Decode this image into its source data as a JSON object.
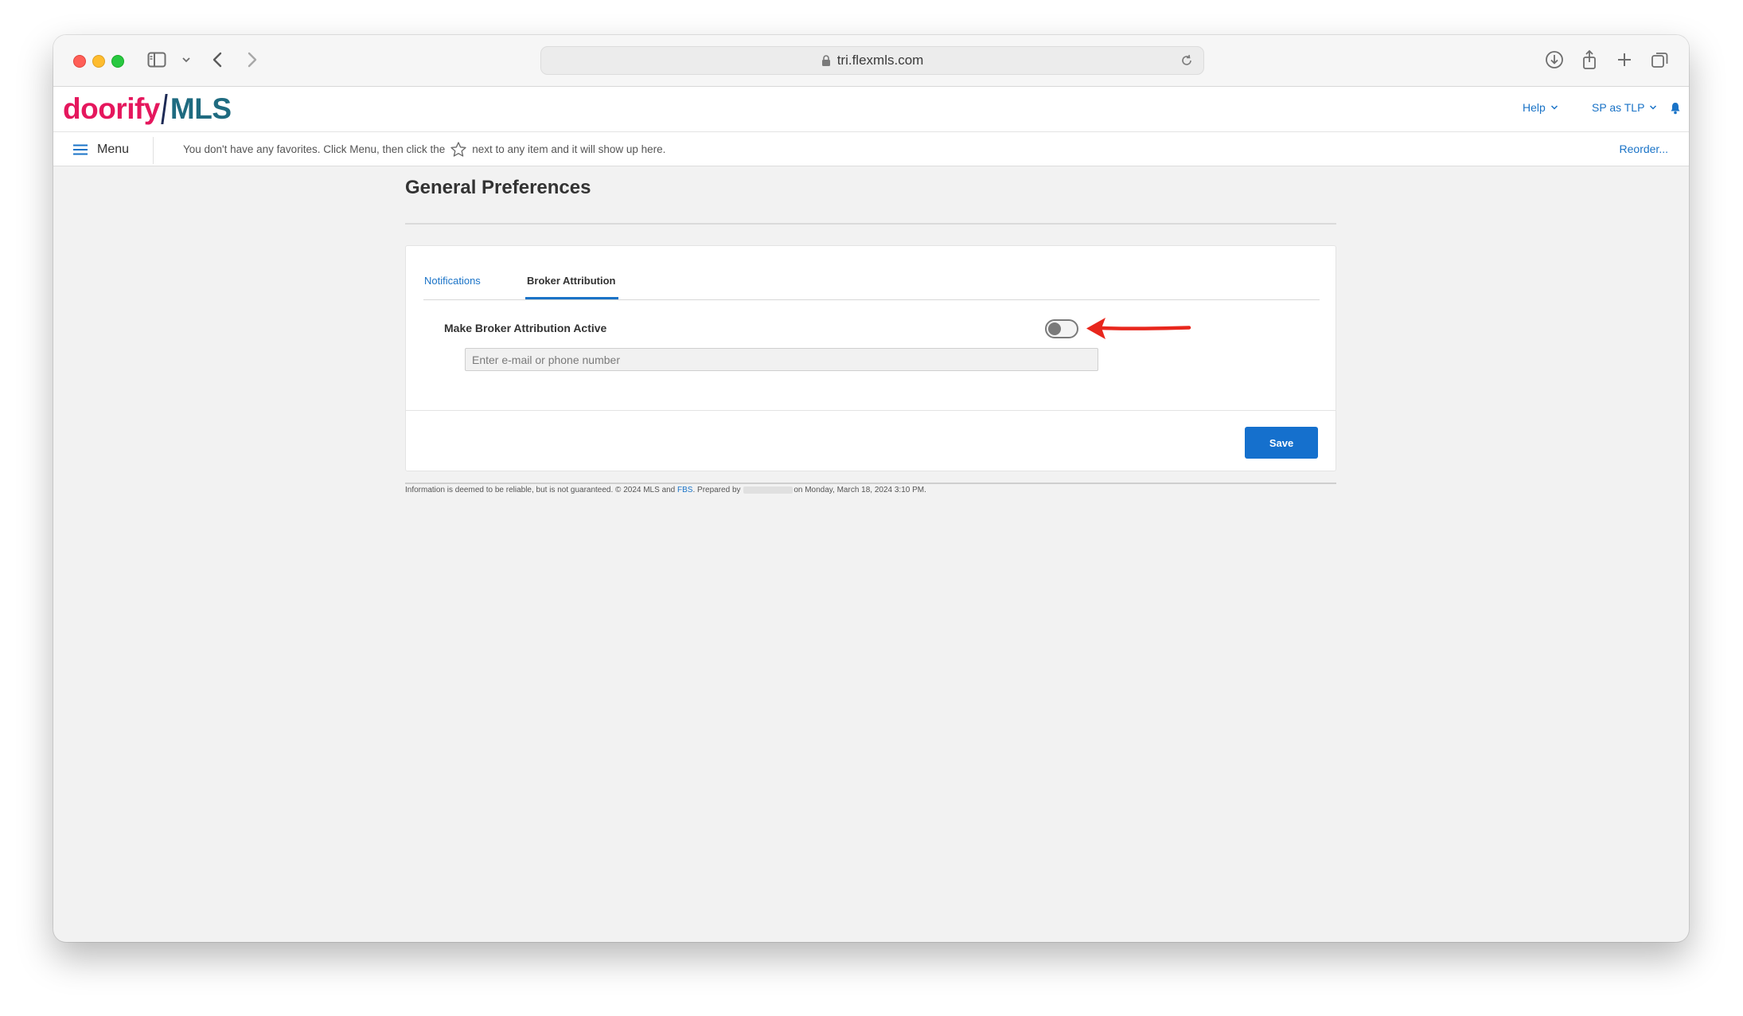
{
  "browser": {
    "url": "tri.flexmls.com"
  },
  "header": {
    "logo_part1": "doorify",
    "logo_part2": "MLS",
    "help_label": "Help",
    "account_label": "SP as TLP"
  },
  "favorites_bar": {
    "menu_label": "Menu",
    "message_before": "You don't have any favorites. Click Menu, then click the",
    "message_after": "next to any item and it will show up here.",
    "reorder_label": "Reorder..."
  },
  "page": {
    "title": "General Preferences",
    "tabs": [
      {
        "label": "Notifications",
        "active": false
      },
      {
        "label": "Broker Attribution",
        "active": true
      }
    ],
    "broker_attribution": {
      "label": "Make Broker Attribution Active",
      "toggle_on": false,
      "input_placeholder": "Enter e-mail or phone number",
      "input_value": ""
    },
    "save_label": "Save"
  },
  "footer": {
    "text_before_link": "Information is deemed to be reliable, but is not guaranteed. © 2024 MLS and",
    "link": "FBS",
    "text_prepared": ". Prepared by",
    "text_after": "on Monday, March 18, 2024 3:10 PM."
  },
  "colors": {
    "brand_pink": "#e5175d",
    "brand_teal": "#1f6b80",
    "link_blue": "#1a73c7",
    "button_blue": "#1570cd",
    "annotation_arrow": "#e8261c"
  }
}
